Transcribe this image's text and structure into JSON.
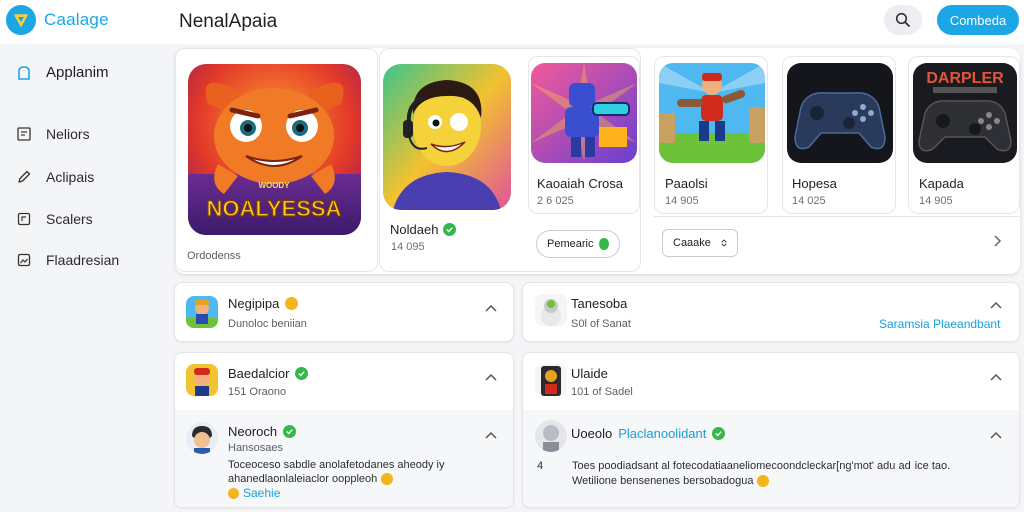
{
  "header": {
    "logo_text": "Caalage",
    "title": "NenalApaia",
    "cta_label": "Combeda",
    "search_icon": "search-icon"
  },
  "sidebar": {
    "items": [
      {
        "label": "Applanim",
        "icon": "home-icon"
      },
      {
        "label": "Neliors",
        "icon": "list-icon"
      },
      {
        "label": "Aclipais",
        "icon": "pen-icon"
      },
      {
        "label": "Scalers",
        "icon": "frame-icon"
      },
      {
        "label": "Flaadresian",
        "icon": "image-icon"
      }
    ]
  },
  "featured": {
    "hero": {
      "art_text": "NOALYESSA",
      "art_subtext": "WOODY",
      "caption": "Ordodenss"
    },
    "mid": {
      "name": "Noldaeh",
      "meta": "14 095",
      "pill_label": "Pemearic"
    },
    "tiles": [
      {
        "name": "Kaoaiah Crosa",
        "meta": "2 6 025"
      },
      {
        "name": "Paaolsi",
        "meta": "14 905"
      },
      {
        "name": "Hopesa",
        "meta": "14 025"
      },
      {
        "name": "Kapada",
        "meta": "14 905",
        "art_text": "DARPLER"
      }
    ],
    "dropdown_label": "Caaake"
  },
  "lists": {
    "left_top": {
      "title": "Negipipa",
      "sub": "Dunoloc beniian"
    },
    "right_top": {
      "title": "Tanesoba",
      "sub": "S0l of Sanat",
      "link": "Saramsia Plaeandbant"
    },
    "left_mid": {
      "title": "Baedalcior",
      "sub": "151 Oraono"
    },
    "right_mid": {
      "title": "Ulaide",
      "sub": "101 of Sadel"
    },
    "left_bottom": {
      "title": "Neoroch",
      "sub": "Hansosaes",
      "body_1": "Toceoceso sabdle anolafetodanes aheody iy",
      "body_2": "ahanedlaonlaleiaclor ooppleoh",
      "link": "Saehie"
    },
    "right_bottom": {
      "title": "Uoeolo",
      "title_link": "Placlanoolidant",
      "marker": "4",
      "body_1": "Toes poodiadsant al fotecodatiaaneliomecoondcleckar[ng'mot' adu ad",
      "body_2": "Wetilione bensenenes bersobadogua",
      "trailing": "ice tao."
    }
  },
  "colors": {
    "accent": "#1ba6e6",
    "verified": "#34b84a",
    "warning": "#f2b51a"
  }
}
